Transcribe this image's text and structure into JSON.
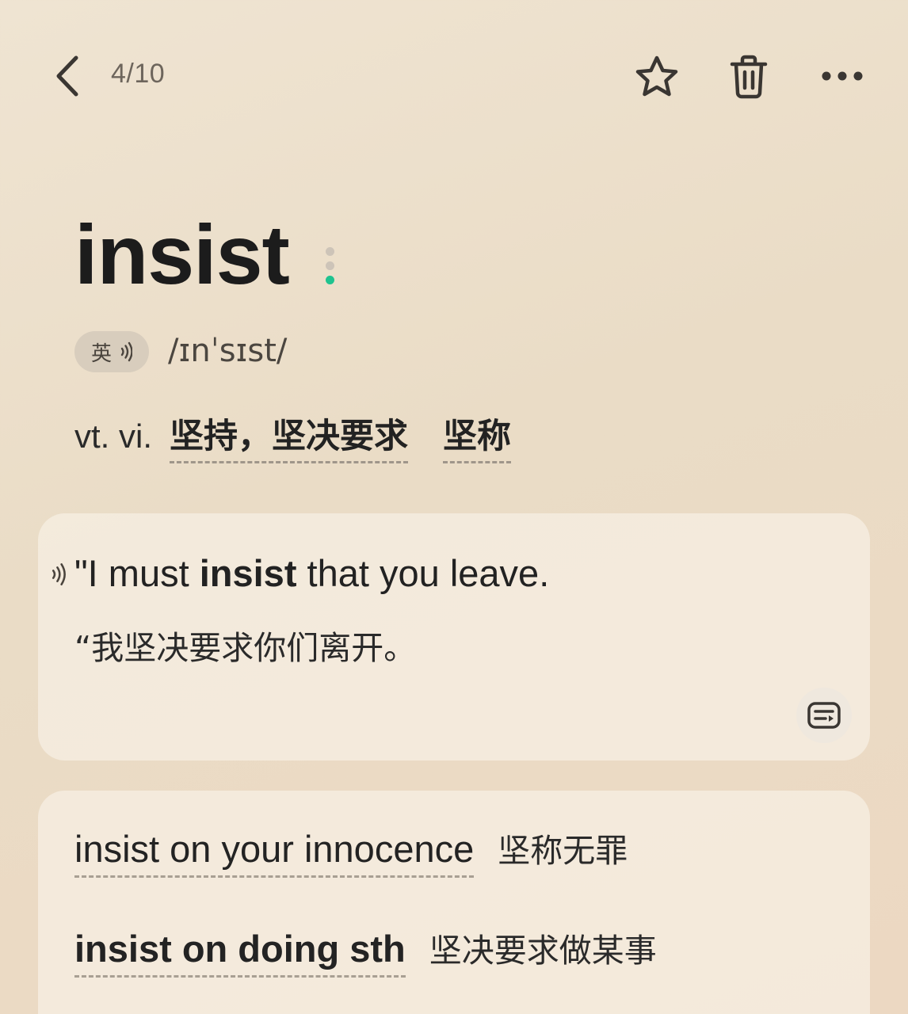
{
  "header": {
    "counter": "4/10",
    "icons": {
      "back": "chevron-left-icon",
      "favorite": "star-outline-icon",
      "delete": "trash-icon",
      "more": "more-horizontal-icon"
    }
  },
  "word": {
    "headword": "insist",
    "pronunciation": {
      "lang_label": "英",
      "phonetic": "/ɪnˈsɪst/"
    },
    "definition": {
      "pos": "vt.  vi.",
      "meanings": [
        "坚持，坚决要求",
        "坚称"
      ]
    }
  },
  "example": {
    "en_prefix": "\"I must ",
    "en_keyword": "insist",
    "en_suffix": " that you leave.",
    "zh": "“我坚决要求你们离开。"
  },
  "phrases": [
    {
      "en": "insist on your innocence",
      "zh": "坚称无罪"
    },
    {
      "en": "insist on doing sth",
      "zh": "坚决要求做某事"
    }
  ],
  "colors": {
    "accent_green": "#1fc38f",
    "background": "#eadcc6",
    "card": "#f7f0e5"
  }
}
